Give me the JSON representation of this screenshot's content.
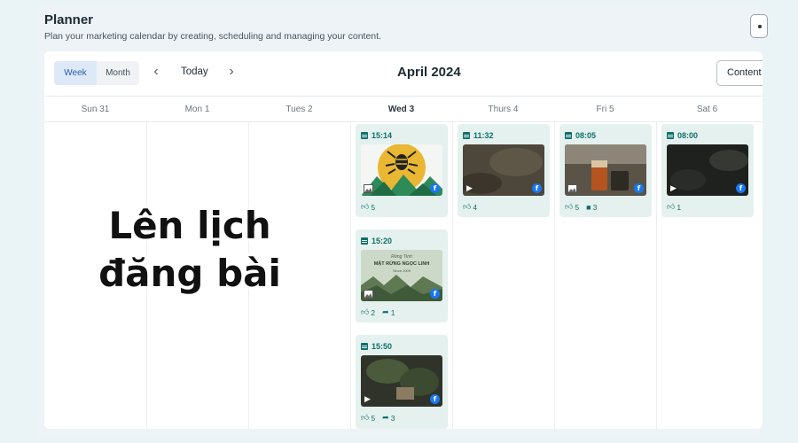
{
  "header": {
    "title": "Planner",
    "subtitle": "Plan your marketing calendar by creating, scheduling and managing your content."
  },
  "toolbar": {
    "week_label": "Week",
    "month_label": "Month",
    "today_label": "Today",
    "month_title": "April 2024",
    "content_label": "Content"
  },
  "days": [
    "Sun 31",
    "Mon 1",
    "Tues 2",
    "Wed 3",
    "Thurs 4",
    "Fri 5",
    "Sat 6"
  ],
  "posts": [
    {
      "time": "15:14",
      "likes": "5",
      "media": "image",
      "day": "Wed 3"
    },
    {
      "time": "15:20",
      "likes": "2",
      "shares": "1",
      "media": "image",
      "day": "Wed 3"
    },
    {
      "time": "15:50",
      "likes": "5",
      "shares": "3",
      "media": "video",
      "day": "Wed 3"
    },
    {
      "time": "11:32",
      "likes": "4",
      "media": "video",
      "day": "Thurs 4"
    },
    {
      "time": "08:05",
      "likes": "5",
      "comments": "3",
      "media": "image",
      "day": "Fri 5"
    },
    {
      "time": "08:00",
      "likes": "1",
      "media": "video",
      "day": "Sat 6"
    }
  ],
  "thumb_text": {
    "small": "Rừng Tình",
    "main": "MẬT RỪNG NGỌC LINH",
    "sub": "Since 2009"
  },
  "overlay": {
    "line1": "Lên lịch",
    "line2": "đăng bài"
  },
  "colors": {
    "accent": "#0f6f6a",
    "post_bg": "#e4f1ee",
    "facebook": "#1877f2",
    "week_active": "#dde9f6"
  }
}
